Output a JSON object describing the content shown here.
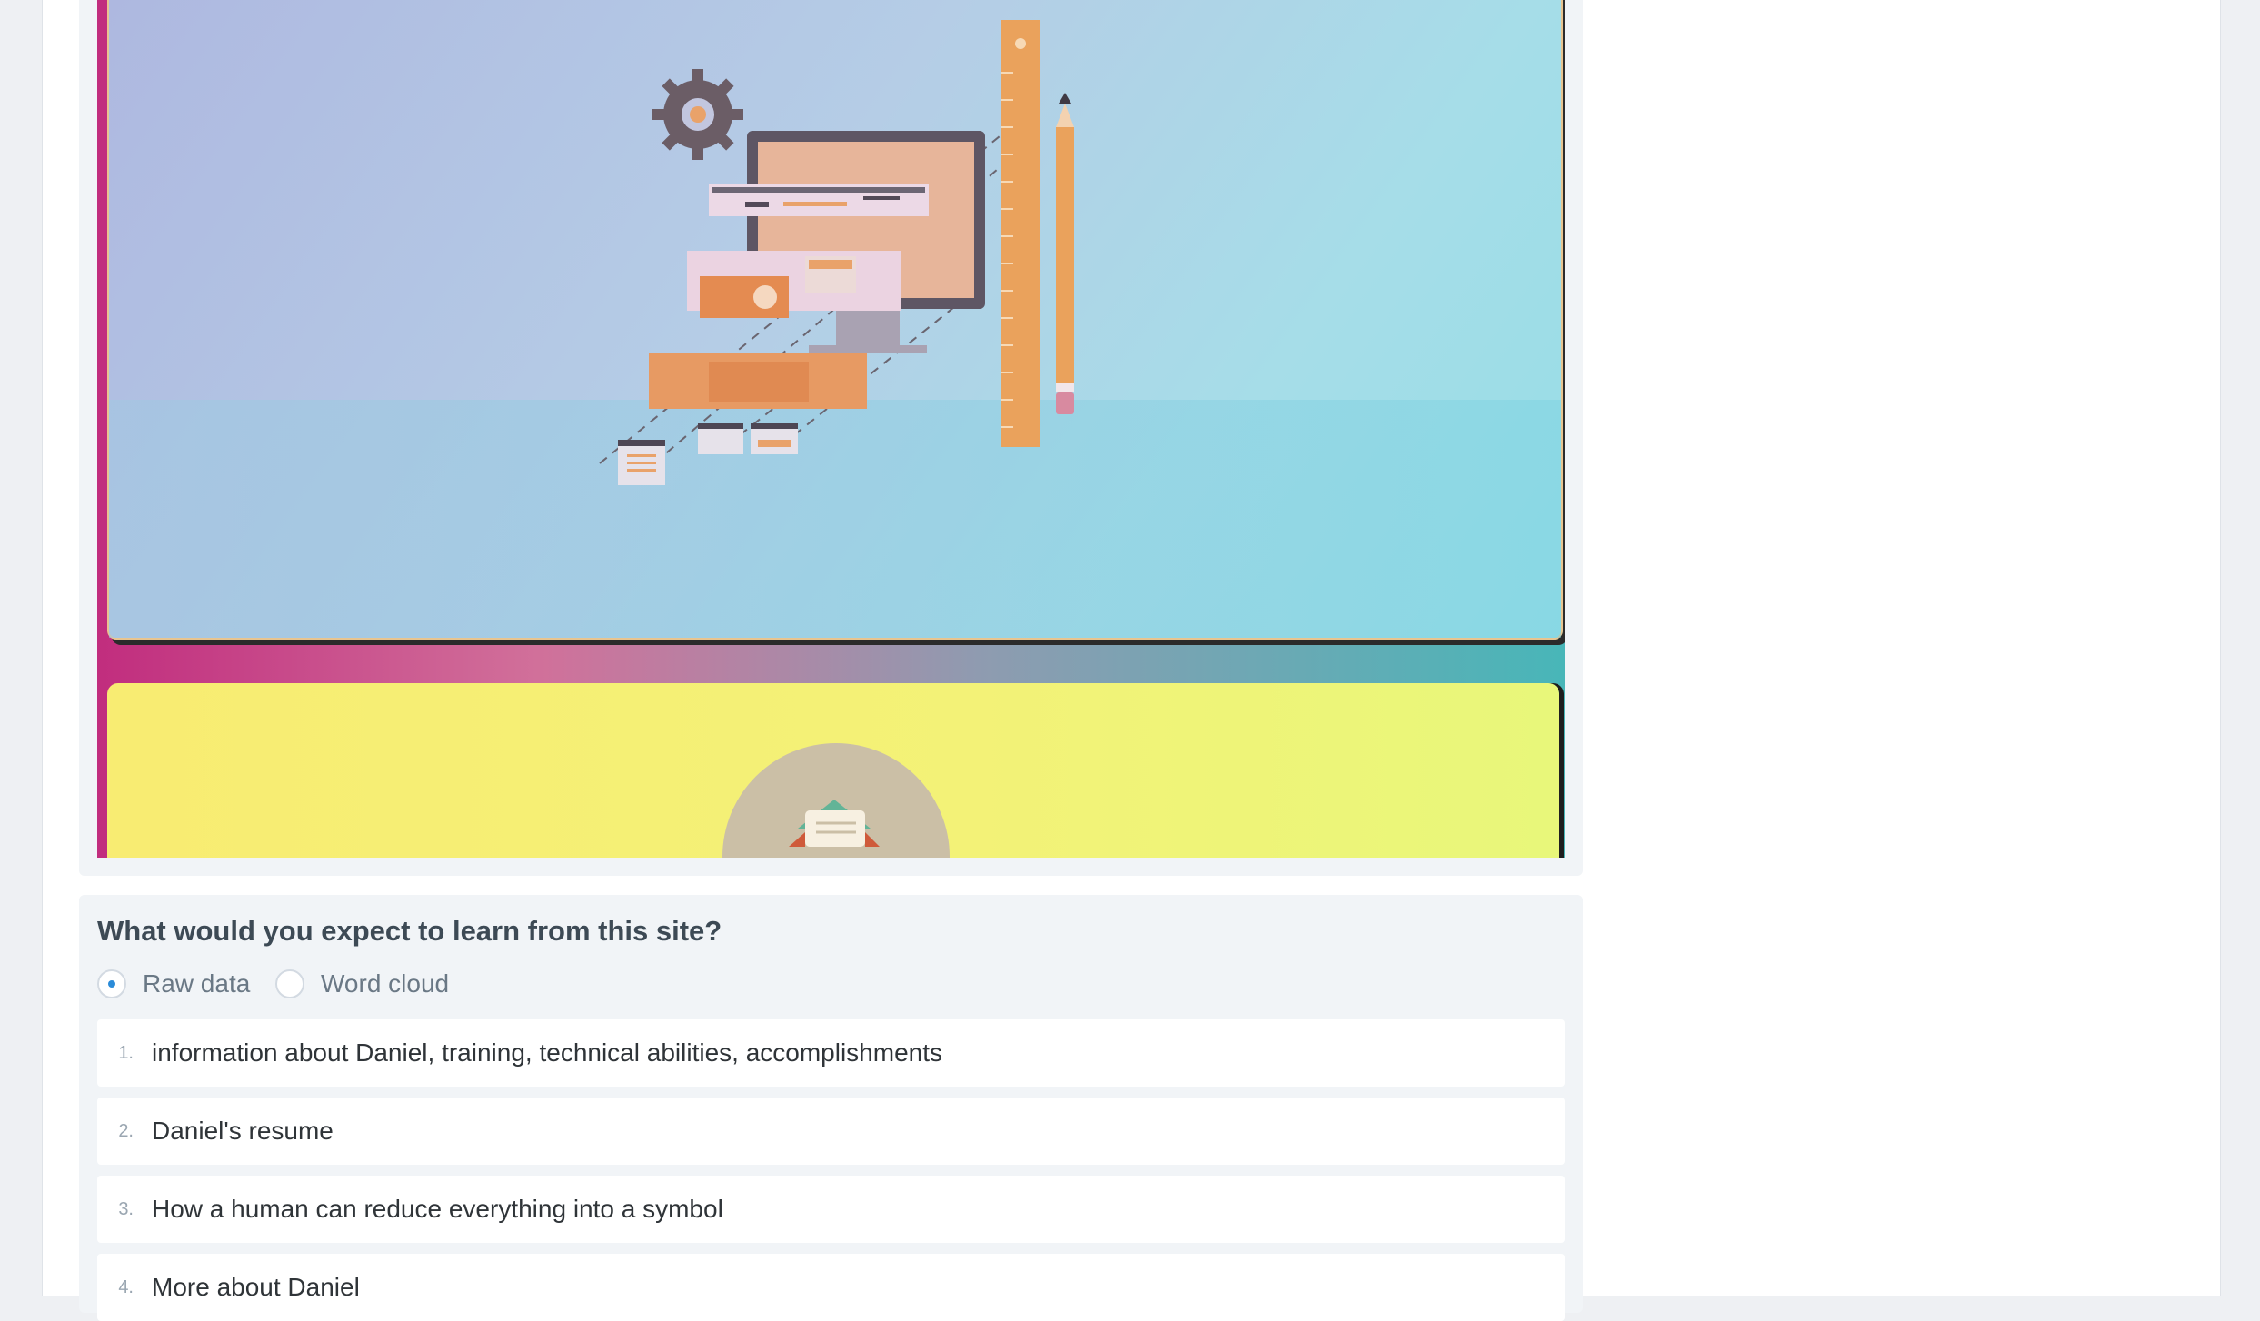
{
  "question": {
    "title": "What would you expect to learn from this site?",
    "modes": [
      {
        "label": "Raw data",
        "selected": true
      },
      {
        "label": "Word cloud",
        "selected": false
      }
    ],
    "answers": [
      {
        "num": "1.",
        "text": "information about Daniel, training, technical abilities, accomplishments"
      },
      {
        "num": "2.",
        "text": "Daniel's resume"
      },
      {
        "num": "3.",
        "text": "How a human can reduce everything into a symbol"
      },
      {
        "num": "4.",
        "text": "More about Daniel"
      }
    ]
  },
  "preview": {
    "illustration_icons": [
      "gear-icon",
      "monitor-icon",
      "ruler-icon",
      "pencil-icon",
      "browser-window-icon"
    ],
    "mail_icon": "envelope-icon",
    "colors": {
      "accent": "#2a8bd8"
    }
  }
}
